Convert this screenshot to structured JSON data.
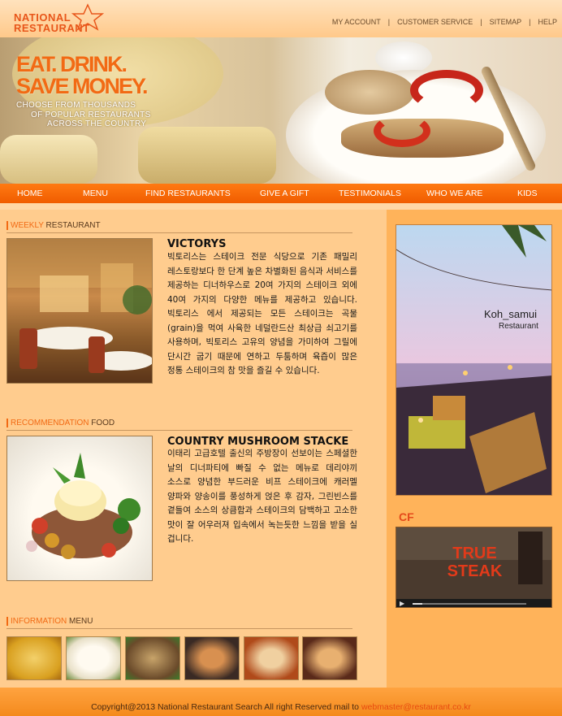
{
  "header": {
    "logo_line1": "NATIONAL",
    "logo_line2": "RESTAURANT",
    "links": [
      "MY ACCOUNT",
      "CUSTOMER SERVICE",
      "SITEMAP",
      "HELP"
    ],
    "separator": "|"
  },
  "hero": {
    "slogan_line1": "EAT. DRINK.",
    "slogan_line2": "SAVE MONEY.",
    "sub_line1": "CHOOSE FROM THOUSANDS",
    "sub_line2": "OF POPULAR RESTAURANTS",
    "sub_line3": "ACROSS THE COUNTRY"
  },
  "nav": {
    "items": [
      "HOME",
      "MENU",
      "FIND RESTAURANTS",
      "GIVE A GIFT",
      "TESTIMONIALS",
      "WHO WE ARE",
      "KIDS"
    ]
  },
  "weekly": {
    "heading_highlight": "WEEKLY",
    "heading_rest": "RESTAURANT",
    "title": "VICTORYS",
    "description": "빅토리스는 스테이크 전문 식당으로 기존 패밀리 레스토랑보다 한 단계 높은 차별화된 음식과 서비스를 제공하는 디너하우스로 20여 가지의 스테이크 외에 40여 가지의 다양한 메뉴를 제공하고 있습니다. 빅토리스 에서 제공되는 모든 스테이크는 곡물(grain)을 먹여 사육한 네덜란드산 최상급 쇠고기를 사용하며, 빅토리스 고유의 양념을 가미하여 그릴에 단시간 굽기 때문에 연하고 두툼하며 육즙이 많은 정통 스테이크의 참 맛을 즐길 수 있습니다."
  },
  "recommend": {
    "heading_highlight": "RECOMMENDATION",
    "heading_rest": "FOOD",
    "title": "COUNTRY MUSHROOM STACKE",
    "description": "이태리 고급호텔 출신의 주방장이 선보이는 스페셜한 날의 디너파티에 빠질 수 없는 메뉴로 데리야끼 소스로 양념한 부드러운 비프 스테이크에 캐러멜 양파와 양송이를 풍성하게 얹은 후 감자, 그린빈스를 곁들여 소스의 상큼함과 스테이크의 담백하고 고소한 맛이 잘 어우러져 입속에서 녹는듯한 느낌을 받을 실 겁니다."
  },
  "info": {
    "heading_highlight": "INFORMATION",
    "heading_rest": "MENU",
    "thumb_colors": [
      "#d9a020",
      "#e8e0c8",
      "#6a4a2a",
      "#3a2a24",
      "#b04a1a",
      "#5a2a1a"
    ]
  },
  "sidebar": {
    "ad_title": "Koh_samui",
    "ad_subtitle": "Restaurant",
    "cf_label": "CF",
    "video_caption_line1": "TRUE",
    "video_caption_line2": "STEAK"
  },
  "footer": {
    "copyright": "Copyright@2013 National Restaurant Search All right Reserved mail to",
    "email": "webmaster@restaurant.co.kr"
  },
  "colors": {
    "accent": "#f26a14",
    "nav": "#f56a0a",
    "background": "#ffcc8e",
    "sidebar": "#ffb35a"
  }
}
